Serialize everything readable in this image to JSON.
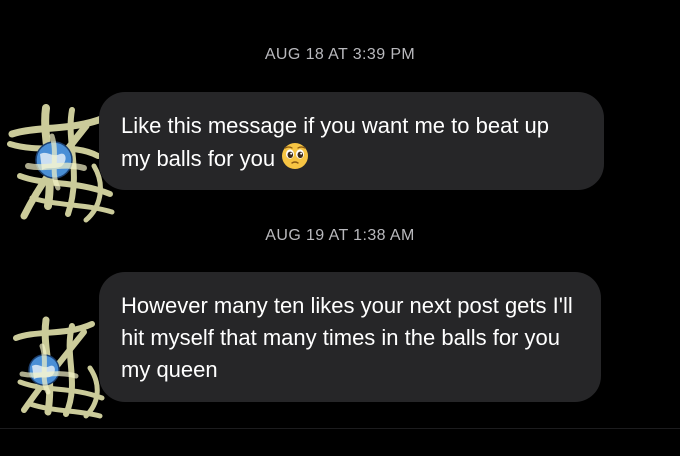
{
  "thread": {
    "messages": [
      {
        "timestamp": "AUG 18 AT 3:39 PM",
        "text": "Like this message if you want me to beat up my balls for you",
        "emoji": "pleading-face-emoji"
      },
      {
        "timestamp": "AUG 19 AT 1:38 AM",
        "text": "However many ten likes your next post gets I'll hit myself that many times in the balls for you my queen"
      }
    ]
  },
  "colors": {
    "background": "#000000",
    "bubble": "#262628",
    "timestamp": "#b9b9bd",
    "message_text": "#ffffff",
    "avatar_scribble": "#e8e7b0",
    "avatar_globe": "#4a8fd6"
  }
}
